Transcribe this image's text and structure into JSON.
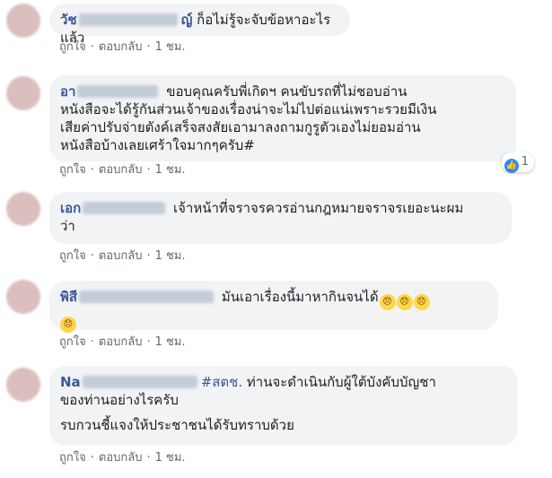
{
  "actions": {
    "like": "ถูกใจ",
    "reply": "ตอบกลับ",
    "time": "1 ชม.",
    "dot": "·"
  },
  "comments": [
    {
      "name": "วัช",
      "name_tail": "ญ์",
      "lines": [
        "ก็อไม่รู้จะจับข้อหาอะไรแล้ว"
      ]
    },
    {
      "name": "อา",
      "name_tail": "",
      "lines": [
        "ขอบคุณครับพี่เกิดฯ คนขับรถที่ไม่ชอบอ่าน",
        "หนังสือจะได้รู้กันส่วนเจ้าของเรื่องน่าจะไม่ไปต่อแน่เพราะรวยมีเงิน",
        "เสียค่าปรับจ่ายตังค์เสร็จสงสัยเอามาลงถามกูรูตัวเองไม่ยอมอ่าน",
        "หนังสือบ้างเลยเศร้าใจมากๆครับ#"
      ],
      "reaction_count": "1"
    },
    {
      "name": "เอก",
      "name_tail": "",
      "lines": [
        "เจ้าหน้าที่จราจรควรอ่านกฎหมายจราจรเยอะนะผม",
        "ว่า"
      ]
    },
    {
      "name": "พิสี",
      "name_tail": "",
      "lines": [
        "มันเอาเรื่องนี้มาหากินจนได้"
      ]
    },
    {
      "name": "Na",
      "name_tail": "",
      "hashtag": "#สตช.",
      "lines": [
        "ท่านจะดำเนินกับผู้ใต้บังคับบัญชา",
        "ของท่านอย่างไรครับ"
      ],
      "extra": "รบกวนชี้แจงให้ประชาชนได้รับทราบด้วย"
    }
  ]
}
